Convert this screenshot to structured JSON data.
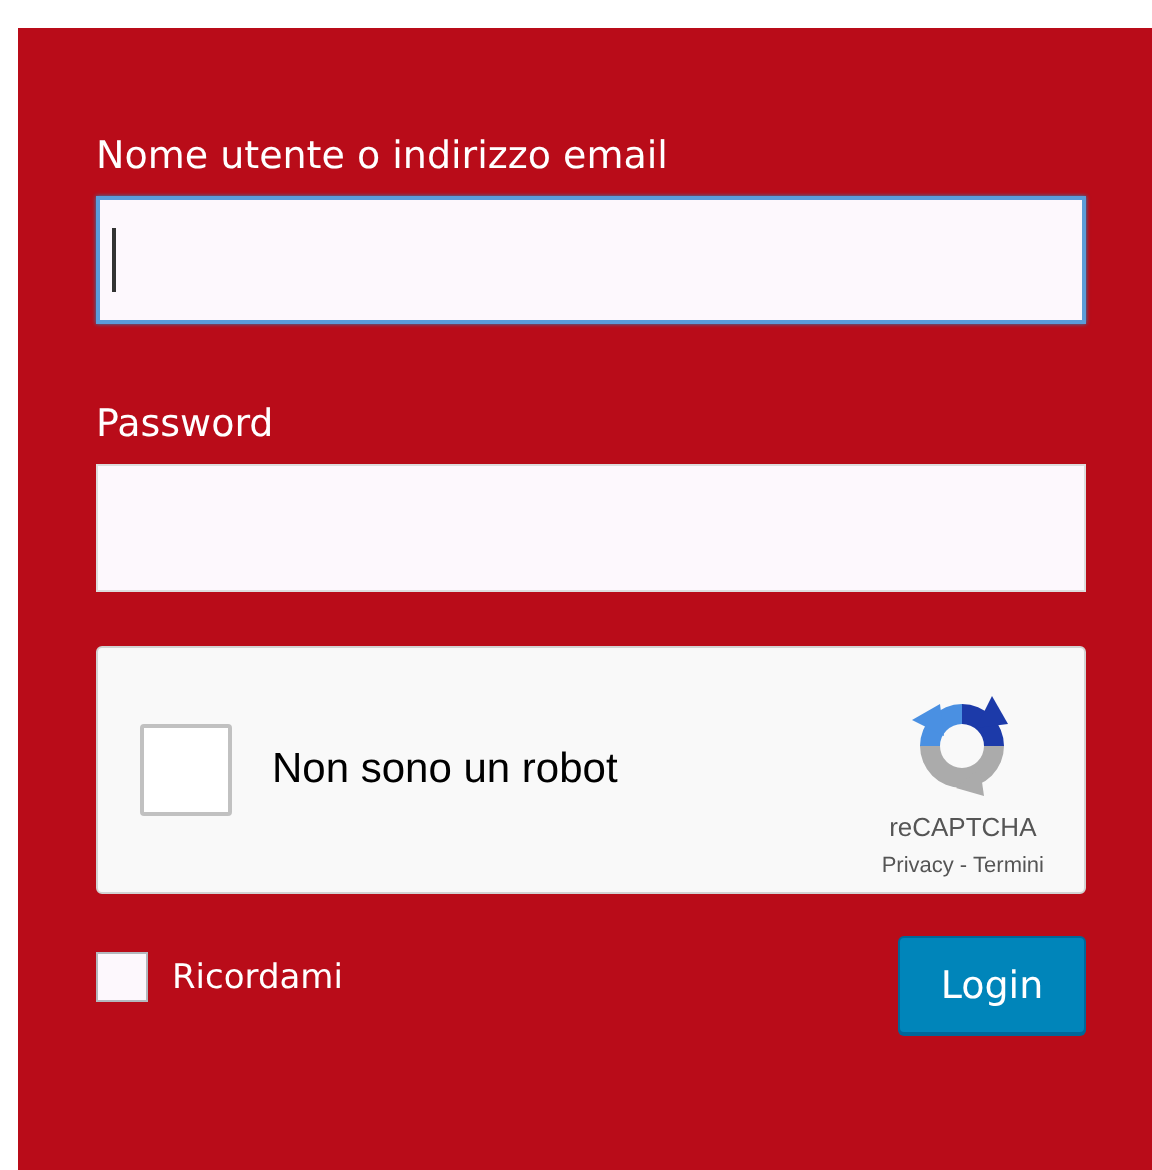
{
  "username": {
    "label": "Nome utente o indirizzo email",
    "focused": true
  },
  "password": {
    "label": "Password"
  },
  "captcha": {
    "label": "Non sono un robot",
    "checked": false,
    "brand": "reCAPTCHA",
    "privacy": "Privacy",
    "separator": "-",
    "terms": "Termini"
  },
  "remember": {
    "label": "Ricordami",
    "checked": false
  },
  "login_button": "Login"
}
